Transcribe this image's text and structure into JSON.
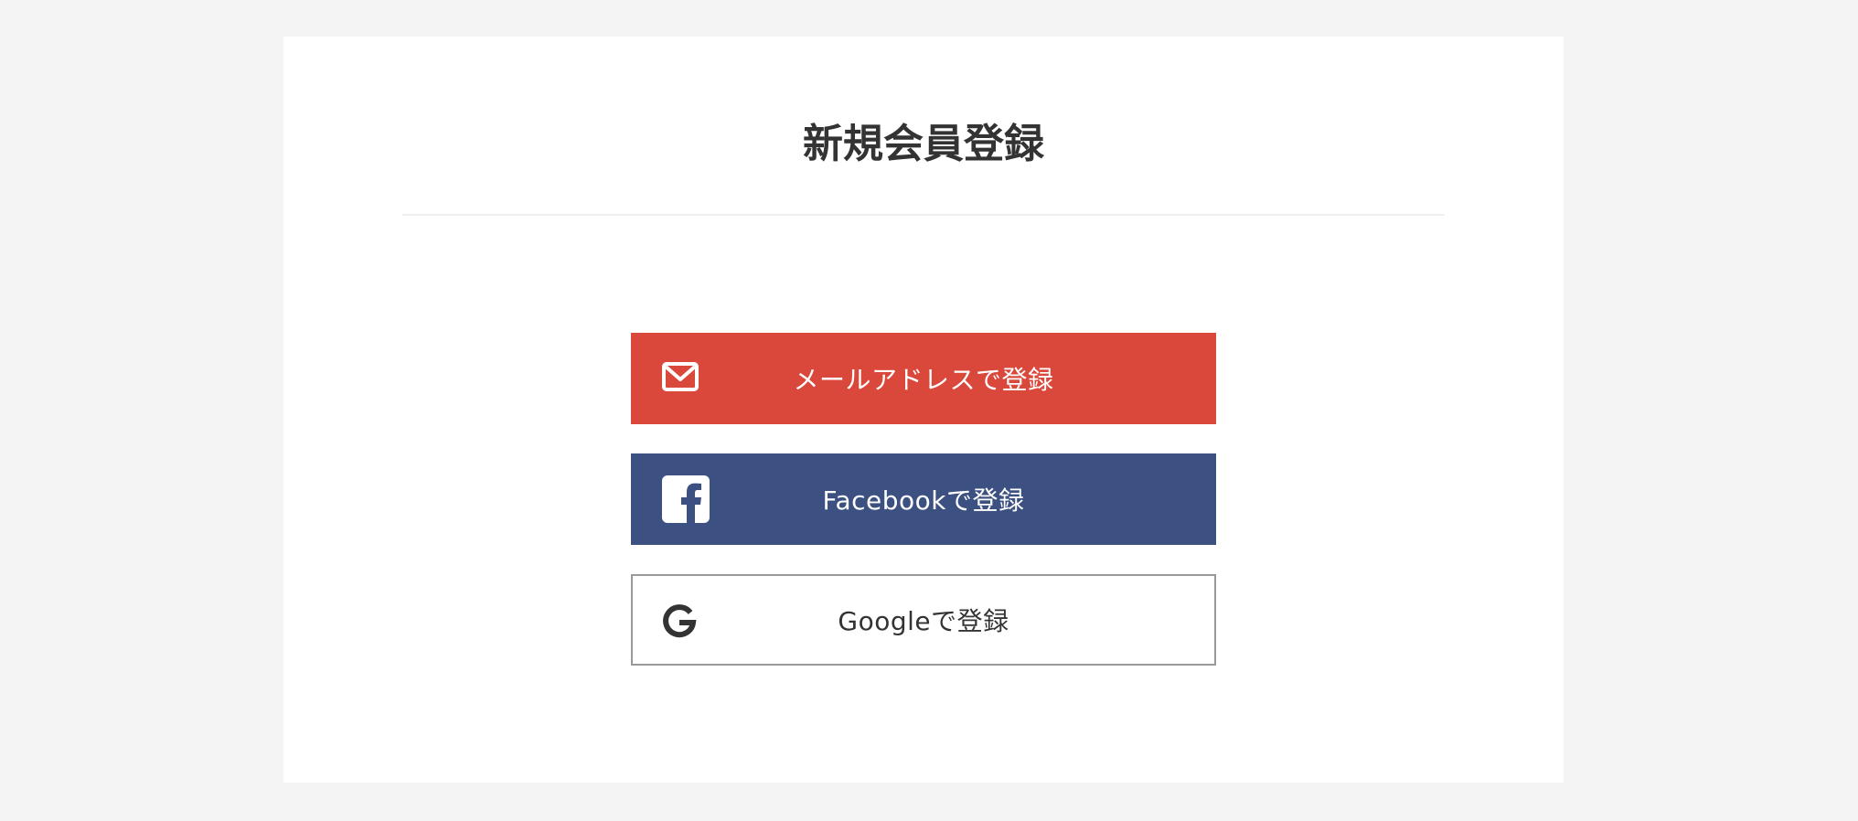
{
  "page": {
    "title": "新規会員登録"
  },
  "signup_buttons": {
    "email": {
      "label": "メールアドレスで登録",
      "icon": "envelope-icon",
      "color": "#d9483b"
    },
    "facebook": {
      "label": "Facebookで登録",
      "icon": "facebook-icon",
      "color": "#3c5182"
    },
    "google": {
      "label": "Googleで登録",
      "icon": "google-icon",
      "color": "#ffffff"
    }
  }
}
